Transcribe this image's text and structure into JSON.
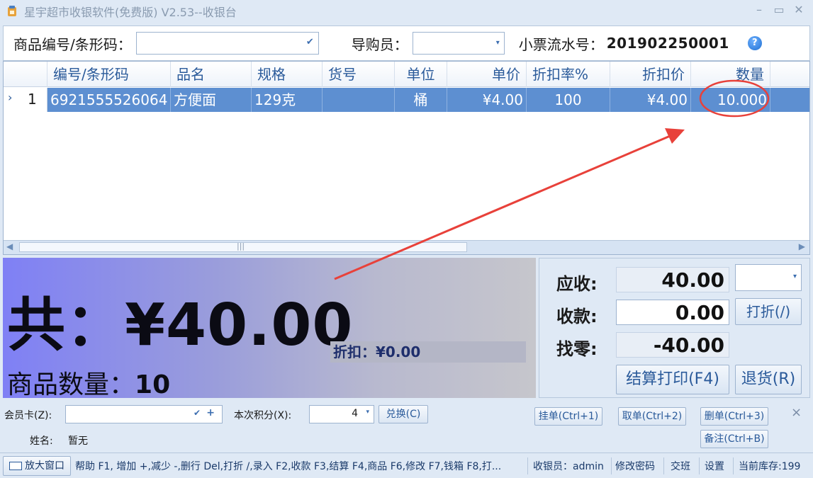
{
  "window": {
    "title": "星宇超市收银软件(免费版) V2.53--收银台",
    "minimize": "–",
    "maximize": "▭",
    "close": "✕"
  },
  "topbar": {
    "barcode_label": "商品编号/条形码：",
    "barcode_value": "",
    "guide_label": "导购员：",
    "guide_value": "",
    "ticket_label": "小票流水号：",
    "ticket_no": "201902250001"
  },
  "grid": {
    "columns": [
      "编号/条形码",
      "品名",
      "规格",
      "货号",
      "单位",
      "单价",
      "折扣率%",
      "折扣价",
      "数量"
    ],
    "rows": [
      {
        "row_no": "1",
        "barcode": "6921555526064",
        "name": "方便面",
        "spec": "129克",
        "item_no": "",
        "unit": "桶",
        "price": "¥4.00",
        "discount_rate": "100",
        "discount_price": "¥4.00",
        "quantity": "10.000"
      }
    ],
    "scroll_grip": "|||"
  },
  "summary": {
    "total_text": "共：¥40.00",
    "discount_text": "折扣：¥0.00",
    "qty_label": "商品数量：",
    "qty_value": "10"
  },
  "payment": {
    "due_label": "应收:",
    "due_value": "40.00",
    "paid_label": "收款:",
    "paid_value": "0.00",
    "change_label": "找零:",
    "change_value": "-40.00",
    "discount_button": "打折(/)",
    "checkout_button": "结算打印(F4)",
    "return_button": "退货(R)"
  },
  "member": {
    "card_label": "会员卡(Z):",
    "card_value": "",
    "points_label": "本次积分(X):",
    "points_value": "4",
    "redeem_button": "兑换(C)",
    "name_label": "姓名:",
    "name_value": "暂无",
    "hold_button": "挂单(Ctrl+1)",
    "fetch_button": "取单(Ctrl+2)",
    "delete_button": "删单(Ctrl+3)",
    "note_button": "备注(Ctrl+B)",
    "close_glyph": "×"
  },
  "statusbar": {
    "zoom_button": "放大窗口",
    "help_text": "帮助 F1, 增加 +,减少 -,删行 Del,打折 /,录入 F2,收款 F3,结算 F4,商品 F6,修改 F7,钱箱 F8,打...",
    "cashier": "收银员：admin",
    "change_password": "修改密码",
    "shift": "交班",
    "settings": "设置",
    "stock": "当前库存:199"
  },
  "annotation": {
    "color": "#e8413a"
  }
}
